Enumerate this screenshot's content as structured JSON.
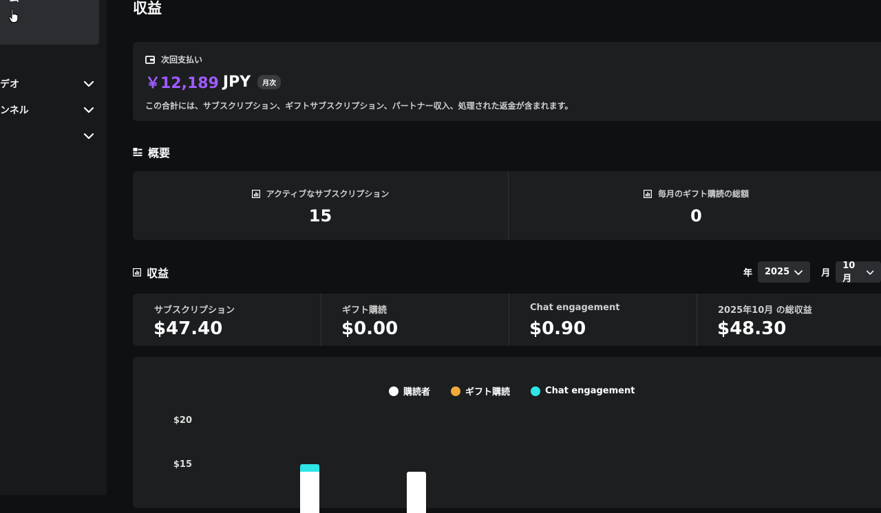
{
  "sidebar": {
    "active_label": "ーム",
    "items": [
      {
        "label": "デオ"
      },
      {
        "label": "ンネル"
      },
      {
        "label": ""
      }
    ]
  },
  "page_title": "収益",
  "payout": {
    "heading": "次回支払い",
    "amount": "￥12,189",
    "currency": "JPY",
    "badge": "月次",
    "description": "この合計には、サブスクリプション、ギフトサブスクリプション、パートナー収入、処理された返金が含まれます。"
  },
  "overview": {
    "heading": "概要",
    "cells": [
      {
        "label": "アクティブなサブスクリプション",
        "value": "15"
      },
      {
        "label": "毎月のギフト購読の総額",
        "value": "0"
      }
    ]
  },
  "revenue": {
    "heading": "収益",
    "year_label": "年",
    "year_value": "2025",
    "month_label": "月",
    "month_value": "10月",
    "stats": [
      {
        "label": "サブスクリプション",
        "value": "$47.40"
      },
      {
        "label": "ギフト購読",
        "value": "$0.00"
      },
      {
        "label": "Chat engagement",
        "value": "$0.90"
      },
      {
        "label": "2025年10月 の総収益",
        "value": "$48.30"
      }
    ]
  },
  "colors": {
    "accent": "#a05bff",
    "subscriber": "#ffffff",
    "gift": "#f0a93a",
    "chat": "#2ee6e6"
  },
  "chart_data": {
    "type": "bar",
    "legend": [
      "購読者",
      "ギフト購読",
      "Chat engagement"
    ],
    "yticks": [
      "$20",
      "$15"
    ],
    "ylim": [
      0,
      20
    ],
    "series": [
      {
        "name": "購読者",
        "values": [
          null,
          null
        ]
      },
      {
        "name": "Chat engagement",
        "values": [
          null,
          null
        ]
      }
    ]
  }
}
